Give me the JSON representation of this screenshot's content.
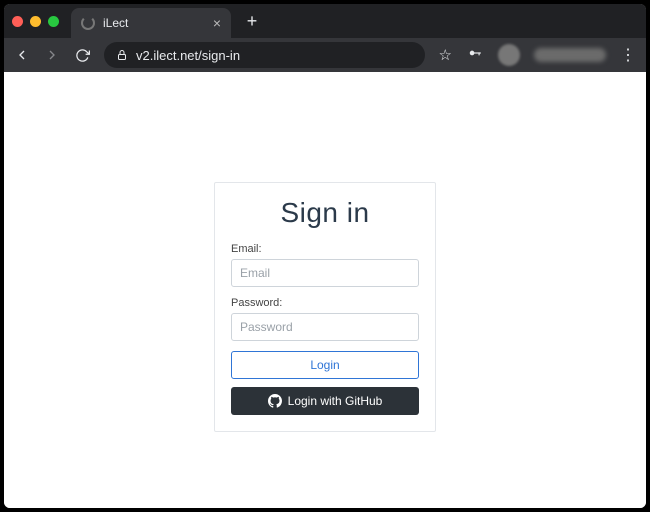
{
  "browser": {
    "tab_title": "iLect",
    "url": "v2.ilect.net/sign-in"
  },
  "signin": {
    "heading": "Sign in",
    "email_label": "Email:",
    "email_placeholder": "Email",
    "password_label": "Password:",
    "password_placeholder": "Password",
    "login_button": "Login",
    "github_button": "Login with GitHub"
  }
}
